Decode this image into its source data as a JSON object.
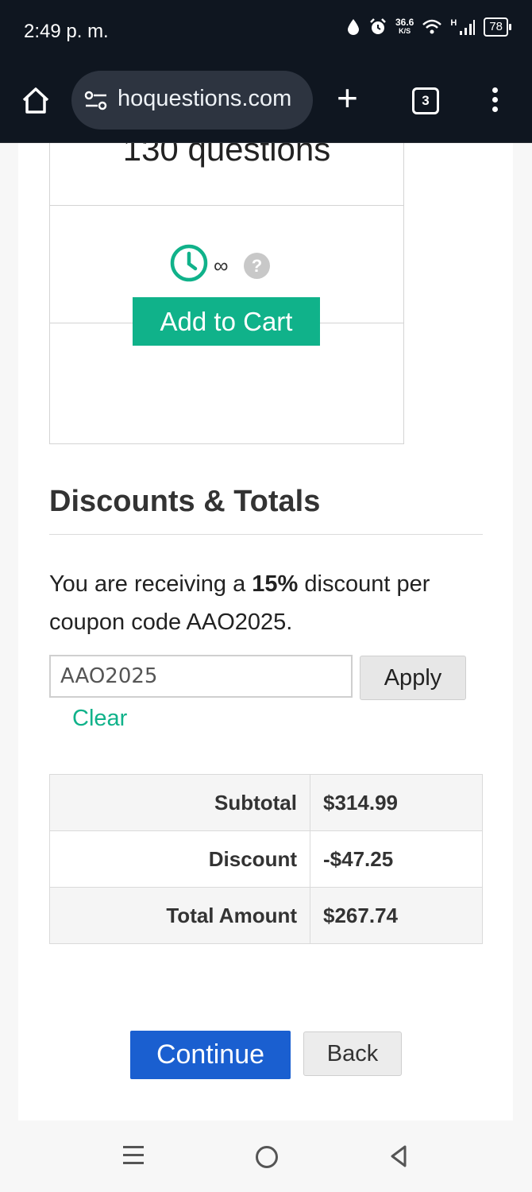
{
  "status_bar": {
    "time": "2:49 p. m.",
    "speed_value": "36.6",
    "speed_unit": "K/S",
    "network": "H",
    "battery": "78"
  },
  "browser": {
    "url": "hoquestions.com",
    "tab_count": "3"
  },
  "product_card": {
    "questions": "130 questions",
    "duration": "∞",
    "help_glyph": "?",
    "add_to_cart": "Add to Cart"
  },
  "discounts": {
    "heading": "Discounts & Totals",
    "message_prefix": "You are receiving a ",
    "message_percent": "15%",
    "message_suffix": " discount per coupon code AAO2025.",
    "coupon_value": "AAO2025",
    "apply_label": "Apply",
    "clear_label": "Clear"
  },
  "totals": [
    {
      "label": "Subtotal",
      "value": "$314.99"
    },
    {
      "label": "Discount",
      "value": "-$47.25"
    },
    {
      "label": "Total Amount",
      "value": "$267.74"
    }
  ],
  "actions": {
    "continue_label": "Continue",
    "back_label": "Back"
  },
  "colors": {
    "accent_green": "#10b28a",
    "primary_blue": "#1a5fd0",
    "status_bg": "#0f1620"
  }
}
